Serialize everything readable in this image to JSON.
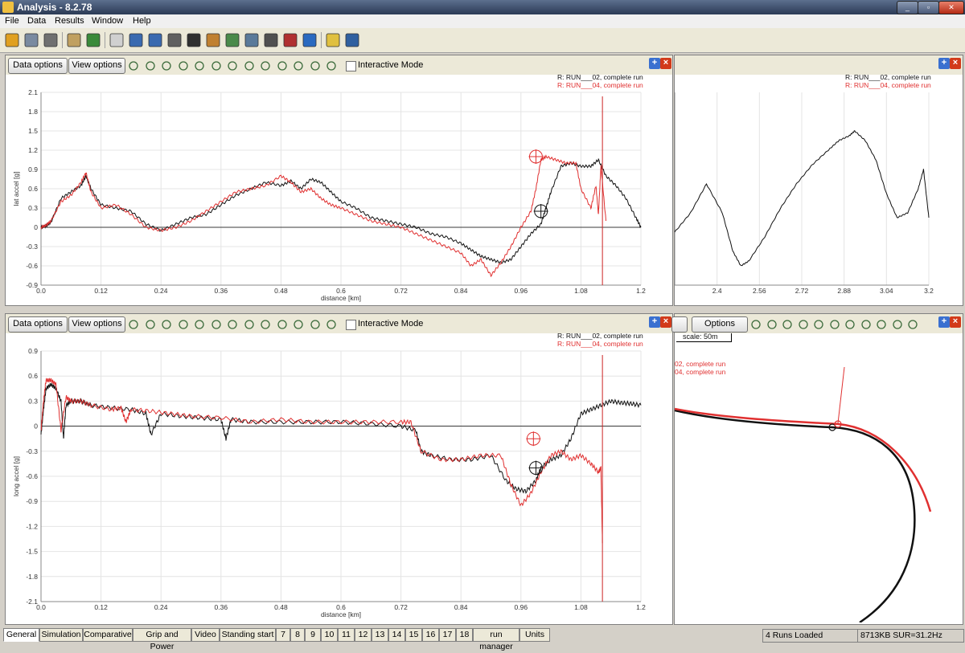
{
  "window": {
    "title": "Analysis - 8.2.78"
  },
  "menu": [
    "File",
    "Data",
    "Results",
    "Window",
    "Help"
  ],
  "toolbar_icons": [
    "open-folder-icon",
    "database-icon",
    "print-icon",
    "clipboard-icon",
    "export-icon",
    "pencil-icon",
    "chart-line-icon",
    "bar-chart-icon",
    "stopwatch-icon",
    "checkered-flag-icon",
    "math-icon",
    "grid-icon",
    "image-chart-icon",
    "film-icon",
    "gauge-icon",
    "play-icon",
    "help-icon",
    "screen-icon"
  ],
  "panels": {
    "top_left": {
      "data_options": "Data options",
      "view_options": "View options",
      "interactive_mode": "Interactive Mode",
      "legend": [
        "R:  RUN___02, complete run",
        "R:  RUN___04, complete run"
      ]
    },
    "top_right": {
      "legend": [
        "R:  RUN___02, complete run",
        "R:  RUN___04, complete run"
      ]
    },
    "bottom_left": {
      "data_options": "Data options",
      "view_options": "View options",
      "interactive_mode": "Interactive Mode",
      "legend": [
        "R:  RUN___02, complete run",
        "R:  RUN___04, complete run"
      ]
    },
    "bottom_right": {
      "options": "Options",
      "scale": "scale: 50m",
      "legend": [
        "02, complete run",
        "04, complete run"
      ]
    }
  },
  "colors": {
    "run02": "#111111",
    "run04": "#e03030",
    "cursor": "#cc2222"
  },
  "chart_data": [
    {
      "type": "line",
      "xlabel": "distance [km]",
      "ylabel": "lat accel [g]",
      "xlim": [
        0.0,
        1.2
      ],
      "ylim": [
        -0.9,
        2.1
      ],
      "xticks": [
        "0.0",
        "0.12",
        "0.24",
        "0.36",
        "0.48",
        "0.6",
        "0.72",
        "0.84",
        "0.96",
        "1.08",
        "1.2"
      ],
      "yticks": [
        "-0.9",
        "-0.6",
        "-0.3",
        "0",
        "0.3",
        "0.6",
        "0.9",
        "1.2",
        "1.5",
        "1.8",
        "2.1"
      ],
      "cursor_x": 1.123,
      "series": [
        {
          "name": "RUN___02",
          "color": "#111111",
          "x": [
            0,
            0.01,
            0.02,
            0.04,
            0.06,
            0.08,
            0.09,
            0.1,
            0.12,
            0.15,
            0.18,
            0.21,
            0.24,
            0.27,
            0.3,
            0.33,
            0.36,
            0.39,
            0.42,
            0.45,
            0.48,
            0.5,
            0.52,
            0.54,
            0.56,
            0.58,
            0.6,
            0.63,
            0.66,
            0.69,
            0.72,
            0.75,
            0.78,
            0.81,
            0.84,
            0.86,
            0.88,
            0.9,
            0.92,
            0.94,
            0.96,
            0.98,
            1.0,
            1.01,
            1.02,
            1.04,
            1.06,
            1.08,
            1.1,
            1.115,
            1.13,
            1.15,
            1.17,
            1.19,
            1.2
          ],
          "y": [
            0,
            0.02,
            0.08,
            0.45,
            0.55,
            0.65,
            0.8,
            0.6,
            0.35,
            0.3,
            0.25,
            0.05,
            -0.05,
            0.05,
            0.15,
            0.2,
            0.35,
            0.5,
            0.6,
            0.7,
            0.65,
            0.72,
            0.6,
            0.75,
            0.7,
            0.55,
            0.4,
            0.3,
            0.15,
            0.1,
            0.05,
            0.0,
            -0.1,
            -0.15,
            -0.25,
            -0.35,
            -0.45,
            -0.5,
            -0.55,
            -0.5,
            -0.3,
            -0.1,
            0.05,
            0.3,
            0.55,
            0.95,
            1.0,
            0.95,
            0.95,
            1.05,
            0.8,
            0.65,
            0.45,
            0.15,
            0.0
          ]
        },
        {
          "name": "RUN___04",
          "color": "#e03030",
          "x": [
            0,
            0.01,
            0.02,
            0.04,
            0.06,
            0.08,
            0.09,
            0.1,
            0.12,
            0.15,
            0.18,
            0.21,
            0.24,
            0.27,
            0.3,
            0.33,
            0.36,
            0.39,
            0.42,
            0.45,
            0.48,
            0.5,
            0.52,
            0.54,
            0.56,
            0.58,
            0.6,
            0.63,
            0.66,
            0.69,
            0.72,
            0.75,
            0.78,
            0.81,
            0.84,
            0.86,
            0.88,
            0.9,
            0.92,
            0.94,
            0.96,
            0.98,
            0.99,
            1.0,
            1.01,
            1.03,
            1.05,
            1.07,
            1.08,
            1.1,
            1.11,
            1.115,
            1.12,
            1.13
          ],
          "y": [
            0,
            0.03,
            0.1,
            0.4,
            0.5,
            0.7,
            0.85,
            0.55,
            0.3,
            0.35,
            0.2,
            0.0,
            -0.05,
            0.0,
            0.1,
            0.25,
            0.4,
            0.55,
            0.6,
            0.65,
            0.8,
            0.7,
            0.55,
            0.6,
            0.45,
            0.35,
            0.3,
            0.2,
            0.1,
            0.05,
            0.0,
            -0.1,
            -0.2,
            -0.3,
            -0.4,
            -0.6,
            -0.5,
            -0.75,
            -0.55,
            -0.3,
            0.0,
            0.25,
            0.6,
            1.05,
            1.1,
            1.05,
            1.0,
            1.0,
            0.6,
            0.3,
            0.65,
            0.2,
            0.95,
            0.1
          ]
        }
      ],
      "markers": [
        {
          "series": "RUN___02",
          "x": 1.0,
          "y": 0.25
        },
        {
          "series": "RUN___04",
          "x": 0.99,
          "y": 1.1
        }
      ]
    },
    {
      "type": "line",
      "xlim": [
        2.24,
        3.2
      ],
      "xticks": [
        "2.4",
        "2.56",
        "2.72",
        "2.88",
        "3.04",
        "3.2"
      ],
      "series": [
        {
          "name": "RUN___02",
          "color": "#111111",
          "x": [
            2.24,
            2.3,
            2.36,
            2.42,
            2.46,
            2.49,
            2.52,
            2.58,
            2.64,
            2.7,
            2.76,
            2.82,
            2.86,
            2.9,
            2.92,
            2.96,
            3.0,
            3.04,
            3.08,
            3.12,
            3.16,
            3.18,
            3.2
          ],
          "y": [
            0.55,
            0.75,
            1.05,
            0.75,
            0.35,
            0.2,
            0.25,
            0.5,
            0.8,
            1.05,
            1.25,
            1.4,
            1.5,
            1.55,
            1.6,
            1.5,
            1.3,
            0.95,
            0.7,
            0.75,
            1.0,
            1.2,
            0.7
          ]
        }
      ]
    },
    {
      "type": "line",
      "xlabel": "distance [km]",
      "ylabel": "long accel [g]",
      "xlim": [
        0.0,
        1.2
      ],
      "ylim": [
        -2.1,
        0.9
      ],
      "xticks": [
        "0.0",
        "0.12",
        "0.24",
        "0.36",
        "0.48",
        "0.6",
        "0.72",
        "0.84",
        "0.96",
        "1.08",
        "1.2"
      ],
      "yticks": [
        "-2.1",
        "-1.8",
        "-1.5",
        "-1.2",
        "-0.9",
        "-0.6",
        "-0.3",
        "0",
        "0.3",
        "0.6",
        "0.9"
      ],
      "cursor_x": 1.123,
      "series": [
        {
          "name": "RUN___02",
          "color": "#111111",
          "x": [
            0,
            0.005,
            0.01,
            0.02,
            0.03,
            0.04,
            0.045,
            0.05,
            0.06,
            0.08,
            0.1,
            0.14,
            0.18,
            0.21,
            0.22,
            0.24,
            0.28,
            0.32,
            0.36,
            0.37,
            0.38,
            0.42,
            0.48,
            0.54,
            0.6,
            0.66,
            0.72,
            0.75,
            0.76,
            0.78,
            0.82,
            0.86,
            0.9,
            0.93,
            0.95,
            0.97,
            0.99,
            1.0,
            1.02,
            1.04,
            1.06,
            1.08,
            1.1,
            1.12,
            1.14,
            1.16,
            1.18,
            1.2
          ],
          "y": [
            -0.1,
            0.2,
            0.45,
            0.5,
            0.45,
            0.3,
            -0.15,
            0.25,
            0.3,
            0.3,
            0.25,
            0.22,
            0.2,
            0.15,
            -0.1,
            0.15,
            0.12,
            0.1,
            0.08,
            -0.15,
            0.08,
            0.05,
            0.05,
            0.05,
            0.05,
            0.03,
            0.0,
            -0.05,
            -0.3,
            -0.35,
            -0.4,
            -0.4,
            -0.35,
            -0.65,
            -0.75,
            -0.78,
            -0.65,
            -0.5,
            -0.4,
            -0.35,
            -0.15,
            0.15,
            0.2,
            0.25,
            0.3,
            0.28,
            0.27,
            0.25
          ]
        },
        {
          "name": "RUN___04",
          "color": "#e03030",
          "x": [
            0,
            0.005,
            0.01,
            0.02,
            0.03,
            0.04,
            0.05,
            0.06,
            0.08,
            0.1,
            0.14,
            0.16,
            0.17,
            0.18,
            0.22,
            0.26,
            0.3,
            0.36,
            0.42,
            0.48,
            0.54,
            0.6,
            0.66,
            0.72,
            0.74,
            0.76,
            0.8,
            0.84,
            0.88,
            0.92,
            0.94,
            0.96,
            0.98,
            1.0,
            1.02,
            1.04,
            1.06,
            1.08,
            1.1,
            1.115,
            1.12,
            1.123
          ],
          "y": [
            -0.05,
            0.3,
            0.55,
            0.55,
            0.5,
            -0.05,
            0.35,
            0.3,
            0.3,
            0.25,
            0.2,
            0.22,
            0.05,
            0.2,
            0.18,
            0.15,
            0.12,
            0.1,
            0.05,
            0.08,
            0.05,
            0.05,
            0.05,
            0.05,
            0.05,
            -0.3,
            -0.4,
            -0.4,
            -0.35,
            -0.35,
            -0.7,
            -0.95,
            -0.8,
            -0.55,
            -0.35,
            -0.3,
            -0.4,
            -0.35,
            -0.45,
            -0.55,
            -0.5,
            -1.4
          ]
        }
      ],
      "markers": [
        {
          "series": "RUN___02",
          "x": 0.99,
          "y": -0.5
        },
        {
          "series": "RUN___04",
          "x": 0.985,
          "y": -0.15
        }
      ]
    }
  ]
}
